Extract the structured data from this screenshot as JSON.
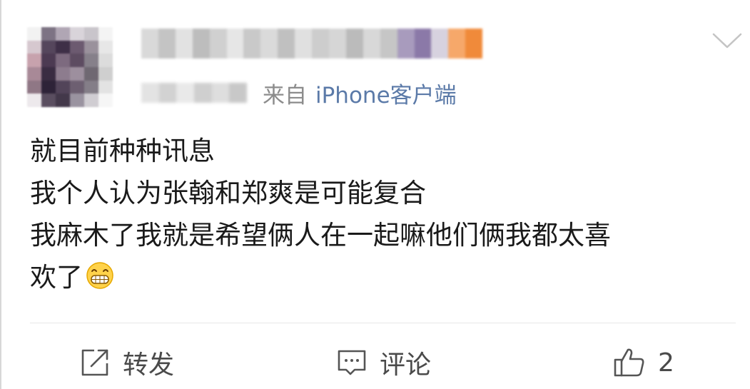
{
  "post": {
    "source_prefix": "来自",
    "source_name": "iPhone客户端",
    "content_lines": [
      "就目前种种讯息",
      "我个人认为张翰和郑爽是可能复合",
      "我麻木了我就是希望俩人在一起嘛他们俩我都太喜",
      "欢了"
    ],
    "emoji_icon": "grin-emoji-icon"
  },
  "actions": {
    "repost_label": "转发",
    "comment_label": "评论",
    "like_count": "2"
  },
  "icons": {
    "repost": "share-square-icon",
    "comment": "comment-bubble-icon",
    "like": "thumbs-up-icon",
    "menu": "chevron-down-icon"
  },
  "colors": {
    "source_link": "#5b7aa8",
    "text": "#1a1a1a",
    "muted": "#8c8c8c",
    "divider": "#e8e8e8"
  }
}
